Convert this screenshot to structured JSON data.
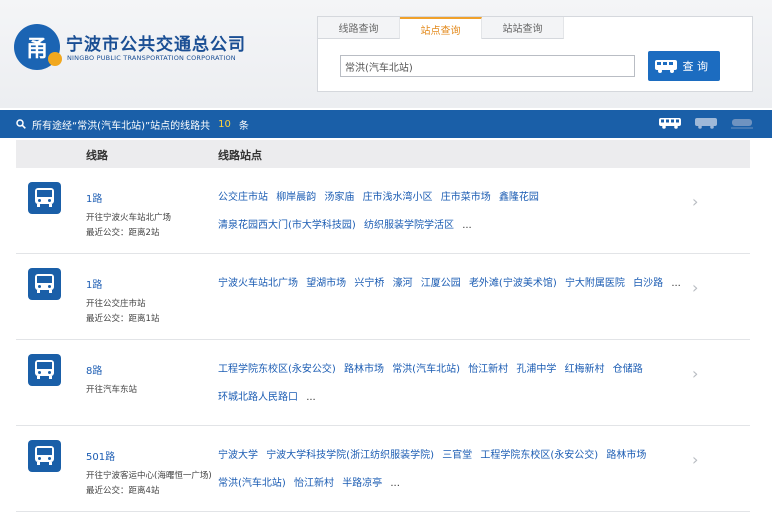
{
  "brand": {
    "name": "宁波市公共交通总公司",
    "name_en": "NINGBO PUBLIC TRANSPORTATION CORPORATION",
    "mark_text": "甬",
    "color": "#1b64b3"
  },
  "search": {
    "tabs": [
      "线路查询",
      "站点查询",
      "站站查询"
    ],
    "active_tab": 1,
    "value": "常洪(汽车北站)",
    "button_label": "查 询"
  },
  "info": {
    "prefix": "所有途经“常洪(汽车北站)”站点的线路共",
    "count": "10",
    "suffix": "条"
  },
  "table": {
    "headers": [
      "线路",
      "线路站点"
    ]
  },
  "routes": [
    {
      "name": "1路",
      "direction": "开往宁波火车站北广场",
      "nearest": "最近公交：距离2站",
      "stops": [
        "公交庄市站",
        "柳岸晨韵",
        "汤家庙",
        "庄市浅水湾小区",
        "庄市菜市场",
        "鑫隆花园",
        "清泉花园西大门(市大学科技园)",
        "纺织服装学院学活区"
      ],
      "more": "..."
    },
    {
      "name": "1路",
      "direction": "开往公交庄市站",
      "nearest": "最近公交：距离1站",
      "stops": [
        "宁波火车站北广场",
        "望湖市场",
        "兴宁桥",
        "濠河",
        "江厦公园",
        "老外滩(宁波美术馆)",
        "宁大附属医院",
        "白沙路"
      ],
      "more": "..."
    },
    {
      "name": "8路",
      "direction": "开往汽车东站",
      "nearest": "",
      "stops": [
        "工程学院东校区(永安公交)",
        "路林市场",
        "常洪(汽车北站)",
        "怡江新村",
        "孔浦中学",
        "红梅新村",
        "仓储路",
        "环城北路人民路口"
      ],
      "more": "..."
    },
    {
      "name": "501路",
      "direction": "开往宁波客运中心(海曙恒一广场)",
      "nearest": "最近公交：距离4站",
      "stops": [
        "宁波大学",
        "宁波大学科技学院(浙江纺织服装学院)",
        "三官堂",
        "工程学院东校区(永安公交)",
        "路林市场",
        "常洪(汽车北站)",
        "怡江新村",
        "半路凉亭"
      ],
      "more": "..."
    }
  ]
}
